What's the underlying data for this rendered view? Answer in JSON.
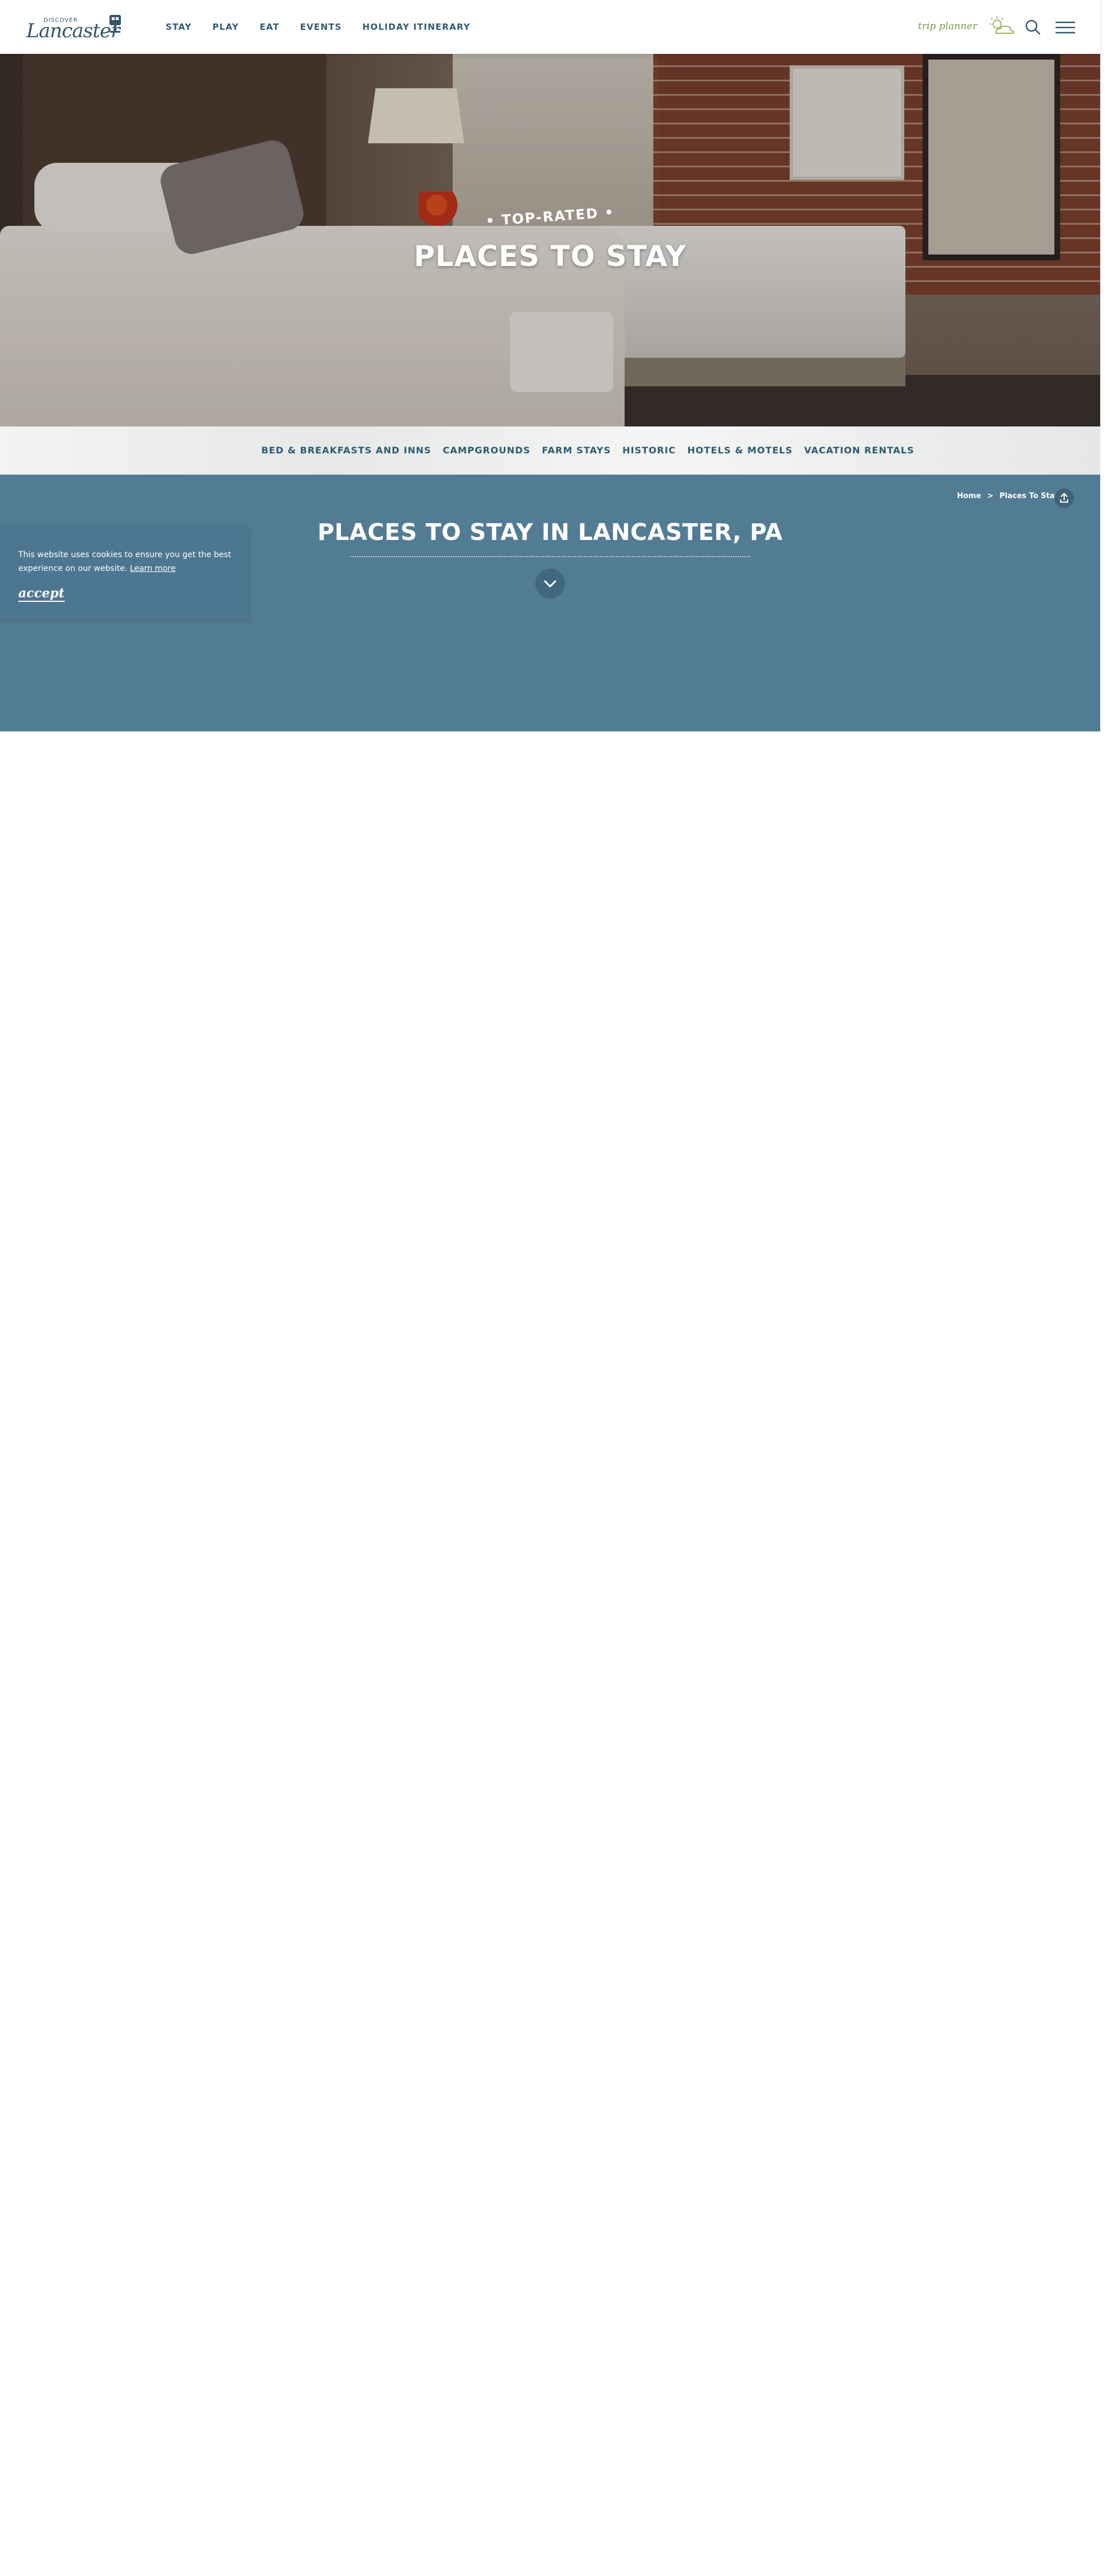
{
  "header": {
    "logo_small": "DISCOVER",
    "logo_script": "Lancaster",
    "nav": [
      "STAY",
      "PLAY",
      "EAT",
      "EVENTS",
      "HOLIDAY ITINERARY"
    ],
    "trip_planner": "trip planner",
    "icons": [
      "weather-icon",
      "search-icon",
      "menu-icon"
    ]
  },
  "hero": {
    "subtitle": "• TOP-RATED •",
    "title": "PLACES TO STAY"
  },
  "subnav": {
    "links": [
      "BED & BREAKFASTS AND INNS",
      "CAMPGROUNDS",
      "FARM STAYS",
      "HISTORIC",
      "HOTELS & MOTELS",
      "VACATION RENTALS"
    ]
  },
  "section": {
    "breadcrumb_home": "Home",
    "breadcrumb_sep": ">",
    "breadcrumb_current": "Places To Stay",
    "title": "PLACES TO STAY IN LANCASTER, PA"
  },
  "cookie": {
    "text": "This website uses cookies to ensure you get the best experience on our website.",
    "learn_more": "Learn more",
    "accept": "accept"
  },
  "colors": {
    "brand_blue": "#527b94",
    "nav_text": "#2f5a70",
    "trip_green": "#7a9b4f"
  }
}
